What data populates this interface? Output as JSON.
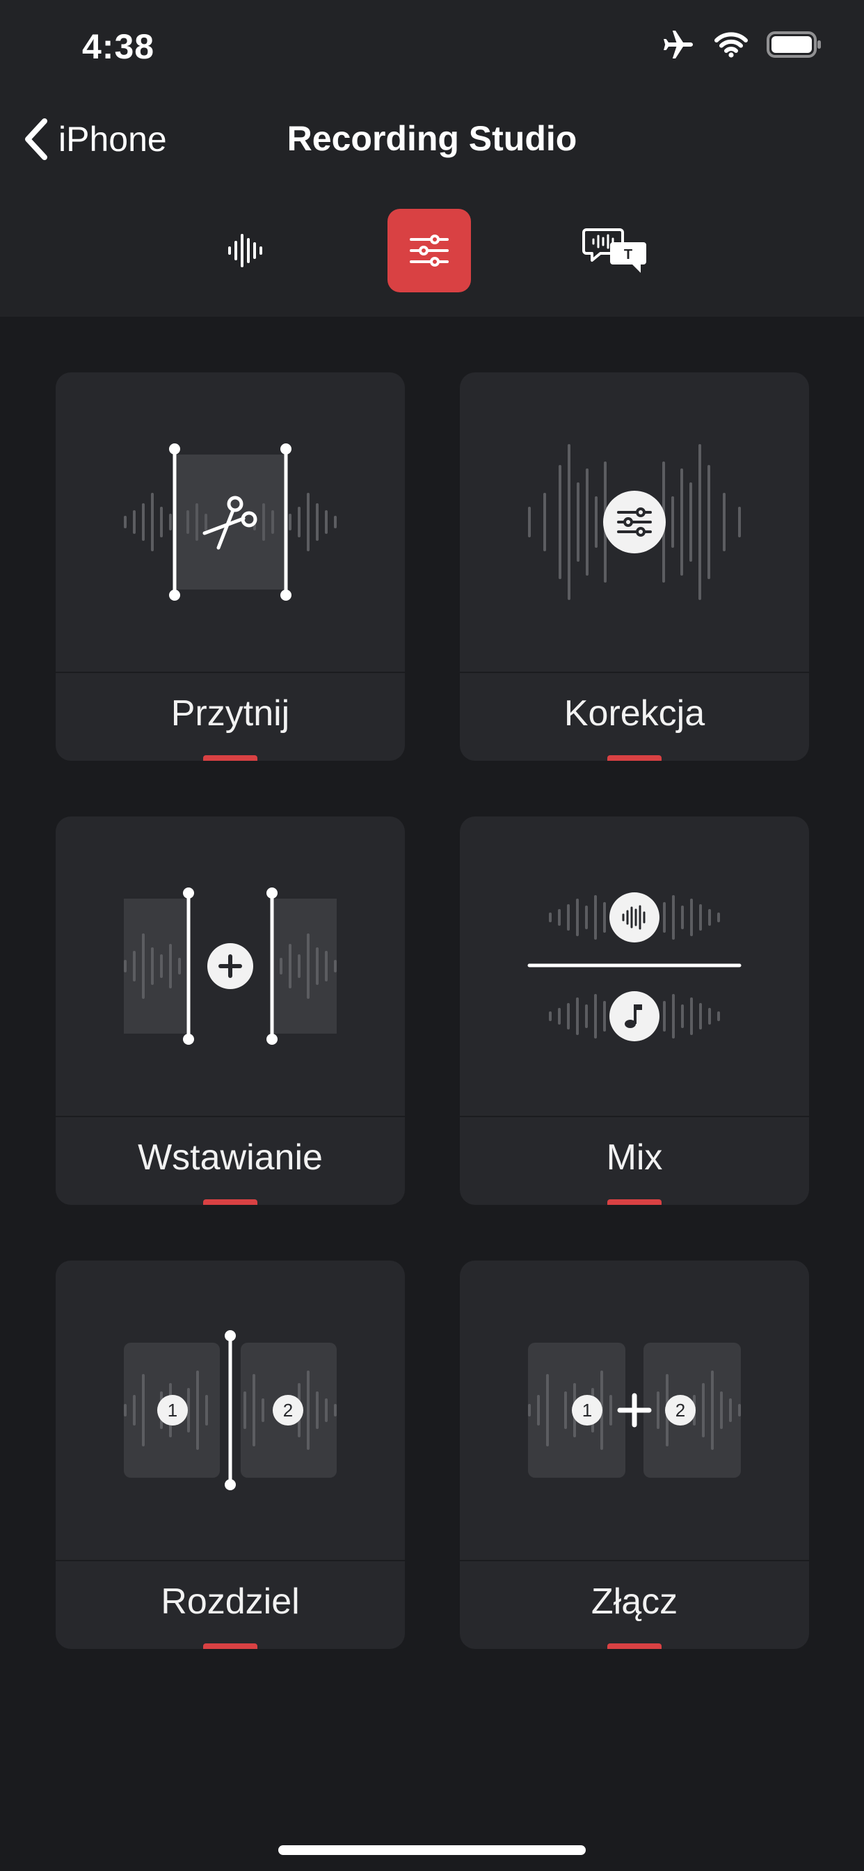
{
  "status_bar": {
    "time": "4:38",
    "icons": [
      "airplane-icon",
      "wifi-icon",
      "battery-icon"
    ]
  },
  "nav": {
    "back_label": "iPhone",
    "title": "Recording Studio"
  },
  "modes": [
    {
      "icon": "waveform-icon",
      "active": false
    },
    {
      "icon": "sliders-icon",
      "active": true
    },
    {
      "icon": "transcript-icon",
      "active": false
    }
  ],
  "tools": [
    {
      "label": "Przytnij",
      "icon": "trim-icon"
    },
    {
      "label": "Korekcja",
      "icon": "equalizer-icon"
    },
    {
      "label": "Wstawianie",
      "icon": "insert-icon"
    },
    {
      "label": "Mix",
      "icon": "mix-icon"
    },
    {
      "label": "Rozdziel",
      "icon": "split-icon",
      "badges": [
        "1",
        "2"
      ]
    },
    {
      "label": "Złącz",
      "icon": "merge-icon",
      "badges": [
        "1",
        "2"
      ]
    }
  ],
  "colors": {
    "accent": "#d94143",
    "background": "#1a1b1e",
    "card": "#27282c",
    "header": "#222326"
  }
}
